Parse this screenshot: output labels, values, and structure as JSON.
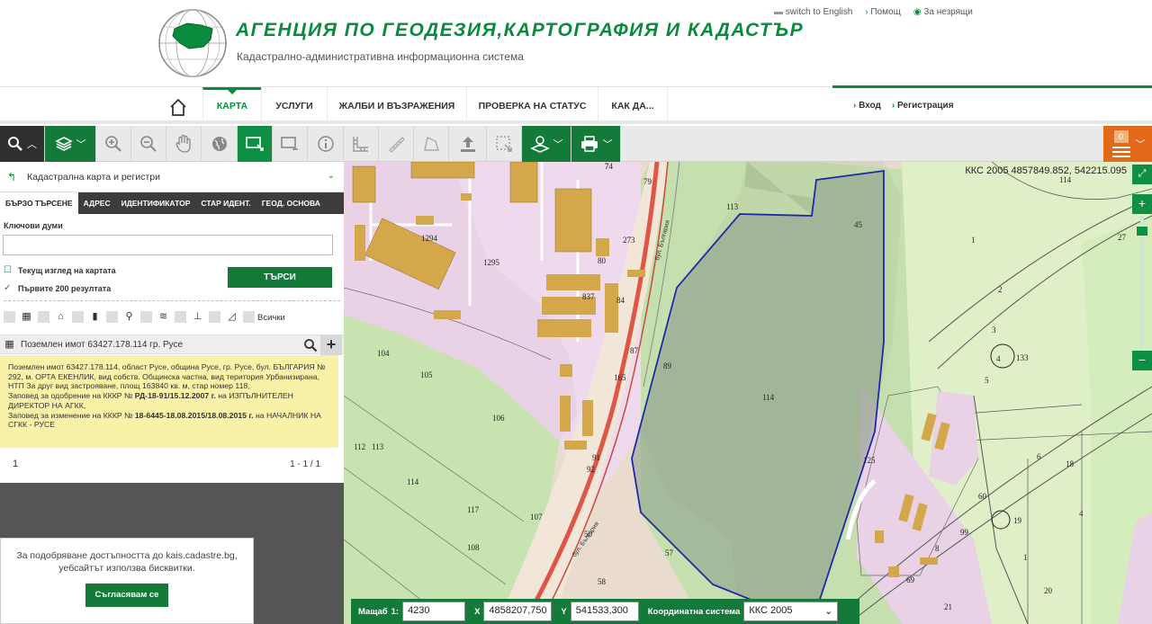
{
  "header": {
    "org_name": "АГЕНЦИЯ ПО ГЕОДЕЗИЯ,КАРТОГРАФИЯ И КАДАСТЪР",
    "subtitle": "Кадастрално-административна информационна система",
    "links": {
      "english": "switch to English",
      "help": "Помощ",
      "accessibility": "За незрящи"
    }
  },
  "nav": {
    "items": [
      "КАРТА",
      "УСЛУГИ",
      "ЖАЛБИ И ВЪЗРАЖЕНИЯ",
      "ПРОВЕРКА НА СТАТУС",
      "КАК ДА..."
    ],
    "login": "Вход",
    "register": "Регистрация"
  },
  "toolbar": {
    "badge_count": "0"
  },
  "panel": {
    "layer": "Кадастрална карта и регистри",
    "tabs": [
      "БЪРЗО ТЪРСЕНЕ",
      "АДРЕС",
      "ИДЕНТИФИКАТОР",
      "СТАР ИДЕНТ.",
      "ГЕОД. ОСНОВА"
    ],
    "keywords_label": "Ключови думи",
    "keywords_value": "",
    "current_view_label": "Текущ изглед на картата",
    "first200_label": "Първите 200 резултата",
    "search_button": "ТЪРСИ",
    "all_label": "Всички",
    "result_title": "Поземлен имот 63427.178.114 гр. Русе",
    "result_text1": "Поземлен имот 63427.178.114, област Русе, община Русе, гр. Русе, бул. БЪЛГАРИЯ № 292, м. ОРТА ЕКЕНЛИК, вид собств. Общинска частна, вид територия Урбанизирана, НТП За друг вид застрояване, площ 163840 кв. м, стар номер 118,",
    "result_text2a": "Заповед за одобрение на КККР №",
    "result_order1": "РД-18-91/15.12.2007 г.",
    "result_text2b": "на ИЗПЪЛНИТЕЛЕН ДИРЕКТОР НА АГКК,",
    "result_text3a": "Заповед за изменение на КККР №",
    "result_order2": "18-6445-18.08.2015/18.08.2015 г.",
    "result_text3b": "на НАЧАЛНИК НА СГКК - РУСЕ",
    "page_num": "1",
    "page_count": "1 - 1 / 1"
  },
  "cookie": {
    "text1": "За подобряване достъпността до kais.cadastre.bg,",
    "text2": "уебсайтът използва бисквитки.",
    "button": "Съгласявам се"
  },
  "map": {
    "coords": "ККС 2005 4857849.852, 542215.095",
    "labels": [
      "74",
      "79",
      "1294",
      "1295",
      "273",
      "80",
      "84",
      "837",
      "87",
      "165",
      "89",
      "92",
      "91",
      "113",
      "45",
      "1",
      "2",
      "3",
      "4",
      "5",
      "133",
      "114",
      "125",
      "104",
      "105",
      "106",
      "112",
      "113",
      "114",
      "117",
      "107",
      "108",
      "50",
      "58",
      "57",
      "60",
      "8",
      "6",
      "18",
      "4",
      "19",
      "99",
      "1",
      "20",
      "21",
      "114",
      "27",
      "69",
      "7"
    ],
    "road_label": "бул. България",
    "scale_label": "Мащаб",
    "scale_prefix": "1:",
    "scale_value": "4230",
    "x_label": "X",
    "x_value": "4858207,750",
    "y_label": "Y",
    "y_value": "541533,300",
    "crs_label": "Координатна система",
    "crs_value": "ККС 2005"
  }
}
